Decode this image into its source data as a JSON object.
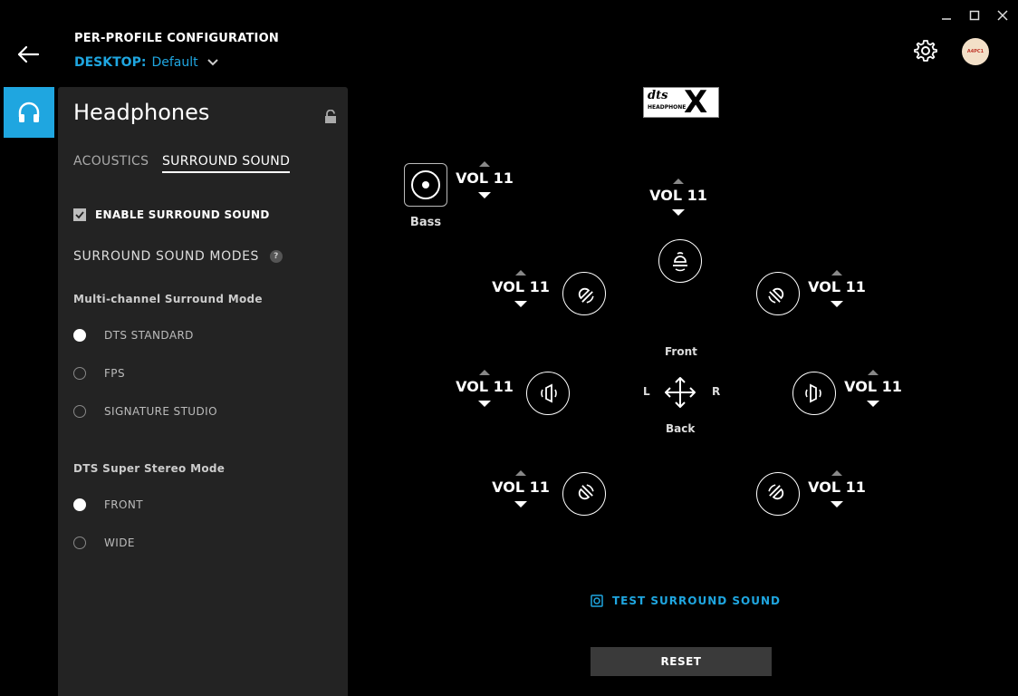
{
  "window": {
    "minimize": "minimize",
    "maximize": "maximize",
    "close": "close"
  },
  "header": {
    "title": "PER-PROFILE CONFIGURATION",
    "profile_label": "DESKTOP:",
    "profile_value": "Default",
    "avatar_text": "A4PC1"
  },
  "panel": {
    "title": "Headphones",
    "tabs": [
      "ACOUSTICS",
      "SURROUND SOUND"
    ],
    "enable_label": "ENABLE SURROUND SOUND",
    "enable_checked": true,
    "modes_title": "SURROUND SOUND MODES",
    "help_glyph": "?",
    "multichannel_title": "Multi-channel Surround Mode",
    "multichannel_options": [
      "DTS STANDARD",
      "FPS",
      "SIGNATURE STUDIO"
    ],
    "multichannel_selected": "DTS STANDARD",
    "stereo_title": "DTS Super Stereo Mode",
    "stereo_options": [
      "FRONT",
      "WIDE"
    ],
    "stereo_selected": "FRONT"
  },
  "main": {
    "logo": {
      "dts": "dts",
      "headphone": "HEADPHONE",
      "x": "X"
    },
    "bass_label": "Bass",
    "volumes": {
      "bass": "VOL 11",
      "center": "VOL 11",
      "front_left": "VOL 11",
      "front_right": "VOL 11",
      "side_left": "VOL 11",
      "side_right": "VOL 11",
      "rear_left": "VOL 11",
      "rear_right": "VOL 11"
    },
    "directions": {
      "front": "Front",
      "back": "Back",
      "left": "L",
      "right": "R"
    },
    "test_label": "TEST SURROUND SOUND",
    "reset_label": "RESET"
  },
  "colors": {
    "accent": "#1fa6e0",
    "panel_bg": "#232323",
    "background": "#000000",
    "reset_bg": "#3a3a3a"
  }
}
